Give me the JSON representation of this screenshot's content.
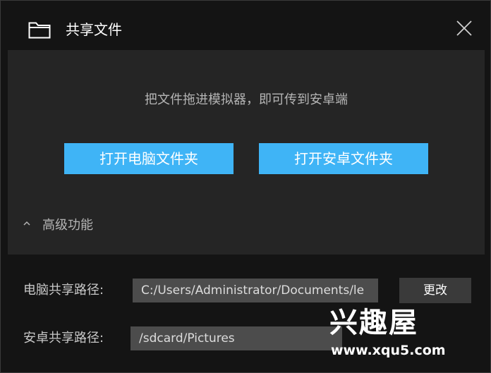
{
  "window": {
    "title": "共享文件",
    "icons": {
      "title": "folder-icon",
      "close": "close-icon"
    }
  },
  "panel": {
    "hint": "把文件拖进模拟器，即可传到安卓端",
    "open_pc_folder_label": "打开电脑文件夹",
    "open_android_folder_label": "打开安卓文件夹",
    "advanced": {
      "label": "高级功能",
      "icon": "chevron-up-icon"
    }
  },
  "settings": {
    "pc_path_label": "电脑共享路径:",
    "pc_path_value": "C:/Users/Administrator/Documents/le",
    "change_label": "更改",
    "android_path_label": "安卓共享路径:",
    "android_path_value": "/sdcard/Pictures"
  },
  "watermark": {
    "title": "兴趣屋",
    "url": "www.xqu5.com"
  },
  "colors": {
    "window_bg": "#141414",
    "panel_bg": "#252525",
    "accent": "#3fb4f6",
    "field_bg": "#4c4c4c"
  }
}
